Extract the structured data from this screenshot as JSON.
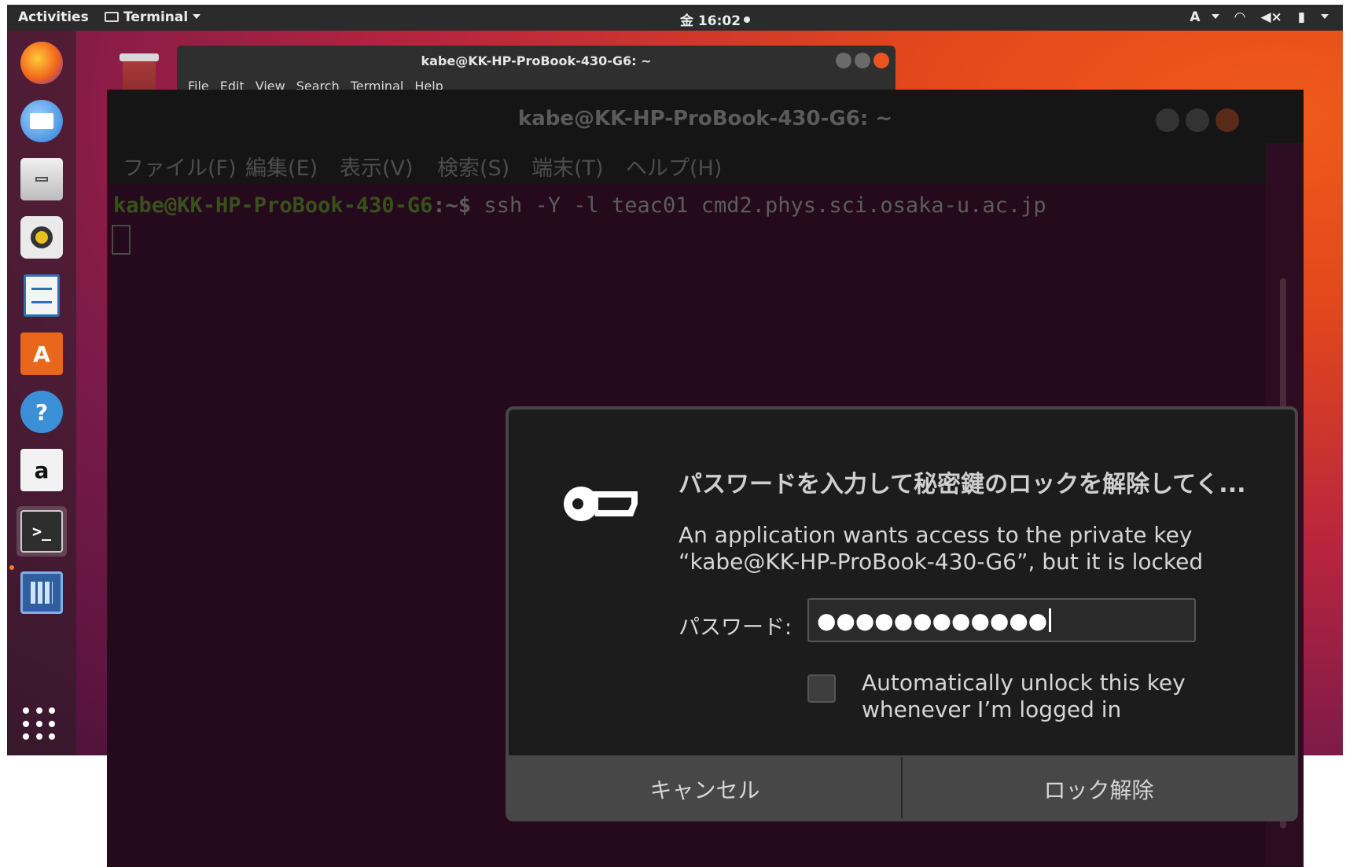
{
  "topbar": {
    "activities": "Activities",
    "app_menu": "Terminal",
    "clock": "金 16:02",
    "tray": {
      "keyboard": "A"
    }
  },
  "dock": {
    "items": [
      {
        "name": "firefox",
        "color": "#e66000"
      },
      {
        "name": "thunderbird",
        "color": "#2a7fd4"
      },
      {
        "name": "files",
        "color": "#8a8a8a"
      },
      {
        "name": "rhythmbox",
        "color": "#e8c020"
      },
      {
        "name": "libreoffice-writer",
        "color": "#2f6fb6"
      },
      {
        "name": "ubuntu-software",
        "color": "#e9671a",
        "text": "A"
      },
      {
        "name": "help",
        "color": "#3a8fd6",
        "text": "?"
      },
      {
        "name": "amazon",
        "color": "#f2f2f2",
        "text": "a"
      },
      {
        "name": "terminal",
        "color": "#2e2e2e",
        "text": ">_"
      },
      {
        "name": "calculator",
        "color": "#2f5f9e"
      }
    ]
  },
  "small_terminal": {
    "title": "kabe@KK-HP-ProBook-430-G6: ~",
    "menu": [
      "File",
      "Edit",
      "View",
      "Search",
      "Terminal",
      "Help"
    ]
  },
  "big_terminal": {
    "title": "kabe@KK-HP-ProBook-430-G6: ~",
    "menu": [
      "ファイル(F)",
      "編集(E)",
      "表示(V)",
      "検索(S)",
      "端末(T)",
      "ヘルプ(H)"
    ],
    "prompt_user": "kabe@KK-HP-ProBook-430-G6",
    "prompt_path": ":~$",
    "command": " ssh -Y -l teac01 cmd2.phys.sci.osaka-u.ac.jp"
  },
  "dialog": {
    "title": "パスワードを入力して秘密鍵のロックを解除してく...",
    "message_line1": "An application wants access to the private key",
    "message_line2": "“kabe@KK-HP-ProBook-430-G6”, but it is locked",
    "password_label": "パスワード:",
    "password_value": "●●●●●●●●●●●●",
    "auto_unlock_line1": "Automatically unlock this key",
    "auto_unlock_line2": "whenever I’m logged in",
    "auto_unlock_checked": false,
    "cancel_label": "キャンセル",
    "unlock_label": "ロック解除"
  }
}
